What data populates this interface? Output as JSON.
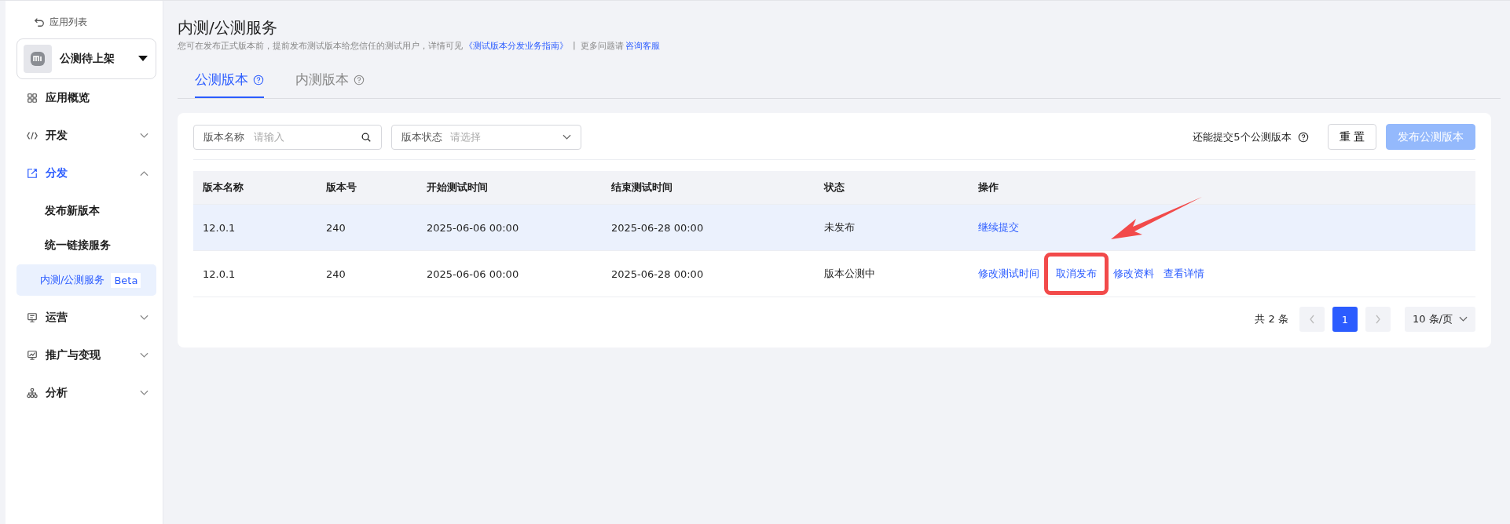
{
  "sidebar": {
    "back_link": "应用列表",
    "app": {
      "name": "公测待上架"
    },
    "items": [
      {
        "label": "应用概览",
        "selected": false
      },
      {
        "label": "开发",
        "expanded": false,
        "selected": false
      },
      {
        "label": "分发",
        "expanded": true,
        "selected": true,
        "children": [
          {
            "label": "发布新版本",
            "selected": false
          },
          {
            "label": "统一链接服务",
            "selected": false
          },
          {
            "label": "内测/公测服务",
            "badge": "Beta",
            "selected": true
          }
        ]
      },
      {
        "label": "运营",
        "expanded": false,
        "selected": false
      },
      {
        "label": "推广与变现",
        "expanded": false,
        "selected": false
      },
      {
        "label": "分析",
        "expanded": false,
        "selected": false
      }
    ]
  },
  "header": {
    "title": "内测/公测服务",
    "description": "您可在发布正式版本前，提前发布测试版本给您信任的测试用户，详情可见",
    "guide_link": "《测试版本分发业务指南》",
    "separator": "|",
    "help_text": "更多问题请",
    "help_link": "咨询客服"
  },
  "tabs": [
    {
      "label": "公测版本",
      "selected": true
    },
    {
      "label": "内测版本",
      "selected": false
    }
  ],
  "filters": {
    "name_field": {
      "label": "版本名称",
      "placeholder": "请输入"
    },
    "status_select": {
      "label": "版本状态",
      "placeholder": "请选择"
    }
  },
  "quota_text": "还能提交5个公测版本",
  "reset_button": "重 置",
  "publish_button": {
    "label": "发布公测版本",
    "disabled": true
  },
  "table": {
    "columns": [
      "版本名称",
      "版本号",
      "开始测试时间",
      "结束测试时间",
      "状态",
      "操作"
    ],
    "rows": [
      {
        "selected": true,
        "cells": [
          "12.0.1",
          "240",
          "2025-06-06 00:00",
          "2025-06-28 00:00",
          "未发布"
        ],
        "actions": [
          {
            "label": "继续提交",
            "highlighted": false
          }
        ]
      },
      {
        "selected": false,
        "cells": [
          "12.0.1",
          "240",
          "2025-06-06 00:00",
          "2025-06-28 00:00",
          "版本公测中"
        ],
        "actions": [
          {
            "label": "修改测试时间",
            "highlighted": false
          },
          {
            "label": "取消发布",
            "highlighted": true
          },
          {
            "label": "修改资料",
            "highlighted": false
          },
          {
            "label": "查看详情",
            "highlighted": false
          }
        ]
      }
    ]
  },
  "pagination": {
    "total": "共 2 条",
    "pages": [
      {
        "label": "1",
        "selected": true
      }
    ],
    "page_size": "10 条/页"
  }
}
